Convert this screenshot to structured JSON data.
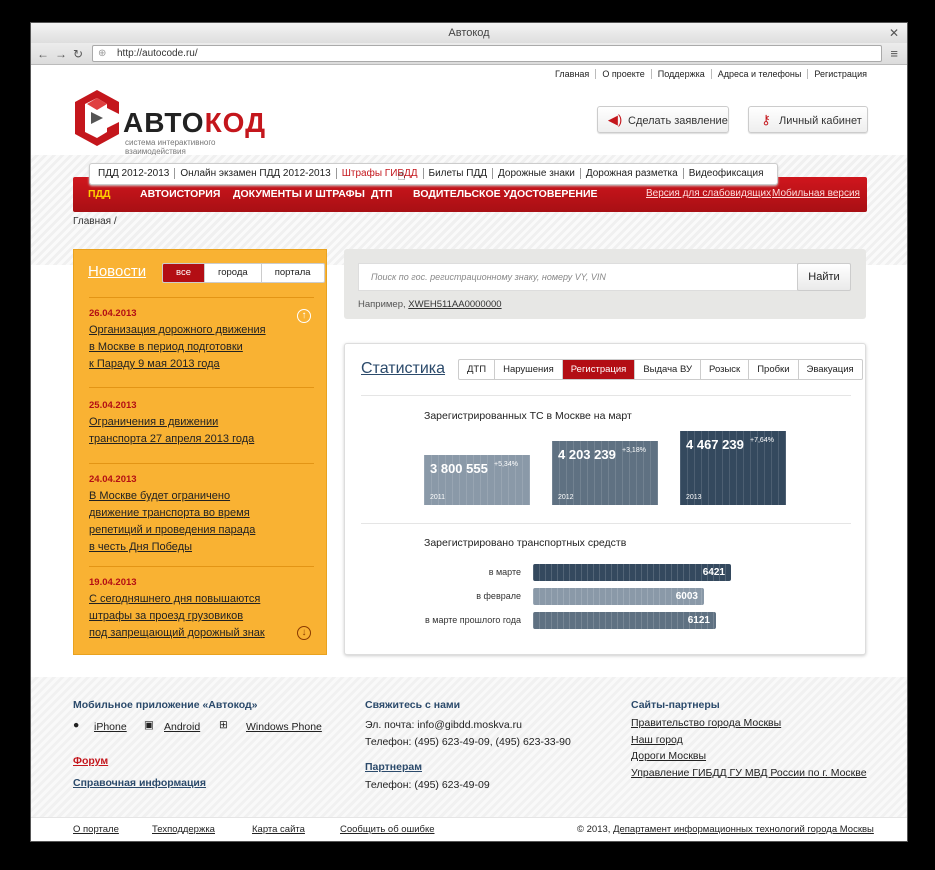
{
  "browser": {
    "title": "Автокод",
    "url": "http://autocode.ru/",
    "close": "✕",
    "back": "←",
    "forward": "→",
    "reload": "↻",
    "menu": "≡"
  },
  "top_links": [
    "Главная",
    "О проекте",
    "Поддержка",
    "Адреса и телефоны",
    "Регистрация"
  ],
  "logo": {
    "word_a": "АВТО",
    "word_b": "КОД",
    "subtitle": "система интерактивного взаимодействия"
  },
  "actions": {
    "apply_label": "Сделать заявление",
    "cabinet_label": "Личный кабинет"
  },
  "submenu": [
    "ПДД 2012-2013",
    "Онлайн экзамен ПДД 2012-2013",
    "Штрафы ГИБДД",
    "Билеты ПДД",
    "Дорожные знаки",
    "Дорожная разметка",
    "Видеофиксация"
  ],
  "main_menu": [
    "ПДД",
    "Автоистория",
    "Документы и штрафы",
    "ДТП",
    "Водительское удостоверение"
  ],
  "right_links": {
    "low_vision": "Версия для слабовидящих",
    "dot": "·",
    "mobile": "Мобильная версия"
  },
  "breadcrumb": "Главная  /",
  "news": {
    "title": "Новости",
    "tabs": [
      "все",
      "города",
      "портала"
    ],
    "items": [
      {
        "date": "26.04.2013",
        "lines": [
          "Организация дорожного движения",
          "в Москве в период подготовки",
          "к Параду 9 мая 2013 года"
        ]
      },
      {
        "date": "25.04.2013",
        "lines": [
          "Ограничения в движении",
          "транспорта 27 апреля 2013 года"
        ]
      },
      {
        "date": "24.04.2013",
        "lines": [
          "В Москве будет ограничено",
          "движение транспорта во время",
          "репетиций и проведения парада",
          "в честь Дня Победы"
        ]
      },
      {
        "date": "19.04.2013",
        "lines": [
          "С сегодняшнего дня повышаются",
          "штрафы за проезд грузовиков",
          "под запрещающий дорожный знак"
        ]
      }
    ]
  },
  "search": {
    "placeholder": "Поиск по гос. регистрационному знаку, номеру VY, VIN",
    "button": "Найти",
    "hint_label": "Например,",
    "hint_example": "XWEH511AA0000000"
  },
  "stats": {
    "title": "Статистика",
    "tabs": [
      "ДТП",
      "Нарушения",
      "Регистрация",
      "Выдача ВУ",
      "Розыск",
      "Пробки",
      "Эвакуация"
    ],
    "active_tab": "Регистрация"
  },
  "chart_data": [
    {
      "type": "bar",
      "title": "Зарегистрированных ТС в Москве на март",
      "categories": [
        "2011",
        "2012",
        "2013"
      ],
      "values": [
        3800555,
        4203239,
        4467239
      ],
      "value_labels": [
        "3 800 555",
        "4 203 239",
        "4 467 239"
      ],
      "change_labels": [
        "+5,34%",
        "+3,18%",
        "+7,64%"
      ],
      "colors": [
        "#8a99a8",
        "#5f7182",
        "#34495e"
      ]
    },
    {
      "type": "bar",
      "title": "Зарегистрировано транспортных средств",
      "categories": [
        "в марте",
        "в феврале",
        "в марте прошлого года"
      ],
      "values": [
        6421,
        6003,
        6121
      ],
      "colors": [
        "#34495e",
        "#8a99a8",
        "#5f7182"
      ]
    }
  ],
  "footer": {
    "app_title": "Мобильное приложение «Автокод»",
    "platforms": [
      "iPhone",
      "Android",
      "Windows Phone"
    ],
    "forum": "Форум",
    "help": "Справочная информация",
    "contact_title": "Свяжитесь с нами",
    "email_label": "Эл. почта:",
    "email": "info@gibdd.moskva.ru",
    "phone_line": "Телефон: (495) 623-49-09, (495) 623-33-90",
    "partners_title": "Партнерам",
    "partners_phone": "Телефон: (495) 623-49-09",
    "sites_title": "Сайты-партнеры",
    "sites": [
      "Правительство города Москвы",
      "Наш город",
      "Дороги Москвы",
      "Управление ГИБДД ГУ МВД России по г. Москве"
    ],
    "bottom_links": [
      "О портале",
      "Техподдержка",
      "Карта сайта",
      "Сообщить об ошибке"
    ],
    "copyright_prefix": "© 2013,",
    "copyright_org": "Департамент информационных технологий города Москвы"
  }
}
